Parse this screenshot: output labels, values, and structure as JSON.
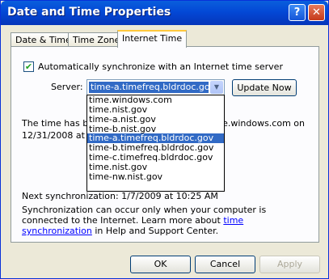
{
  "window": {
    "title": "Date and Time Properties",
    "help_icon": "?",
    "close_icon": "✕"
  },
  "tabs": [
    {
      "label": "Date & Time"
    },
    {
      "label": "Time Zone"
    },
    {
      "label": "Internet Time"
    }
  ],
  "sync": {
    "checkbox_label": "Automatically synchronize with an Internet time server",
    "checked": true
  },
  "server": {
    "label": "Server:",
    "selected": "time-a.timefreq.bldrdoc.gov",
    "update_label": "Update Now",
    "options": [
      "time.windows.com",
      "time.nist.gov",
      "time-a.nist.gov",
      "time-b.nist.gov",
      "time-a.timefreq.bldrdoc.gov",
      "time-b.timefreq.bldrdoc.gov",
      "time-c.timefreq.bldrdoc.gov",
      "time.nist.gov",
      "time-nw.nist.gov"
    ],
    "selected_index": 4
  },
  "status": {
    "line1_start": "The time has bee",
    "line1_end": "me.windows.com on",
    "line2_start": "12/31/2008 at 1"
  },
  "next_sync": "Next synchronization:  1/7/2009 at 10:25 AM",
  "note": {
    "text_before": "Synchronization can occur only when your computer is connected to the Internet.  Learn more about ",
    "link": "time synchronization",
    "text_after": " in Help and Support Center."
  },
  "buttons": {
    "ok": "OK",
    "cancel": "Cancel",
    "apply": "Apply"
  }
}
